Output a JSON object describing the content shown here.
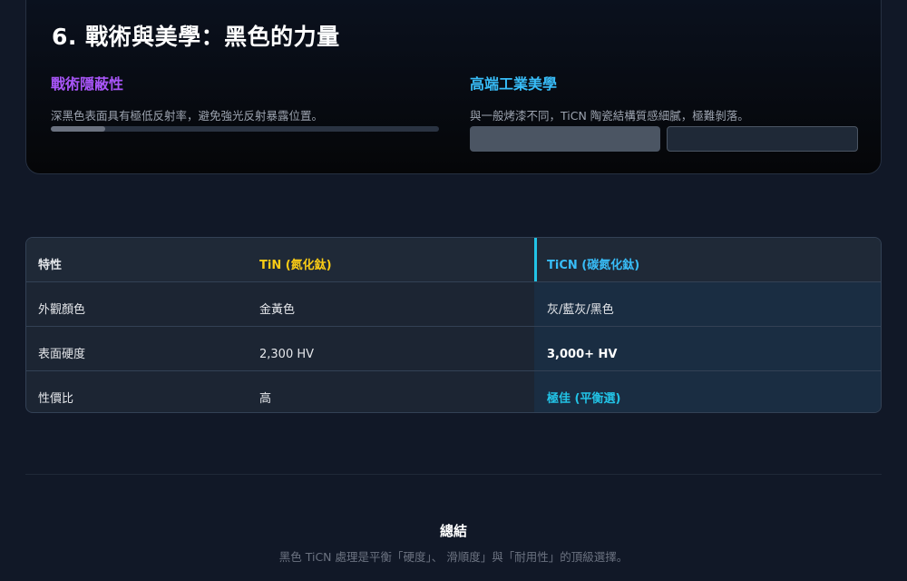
{
  "section": {
    "title": "6. 戰術與美學：黑色的力量",
    "left": {
      "title": "戰術隱蔽性",
      "description": "深黑色表面具有極低反射率，避免強光反射暴露位置。",
      "reflectivity_fraction": 0.14
    },
    "right": {
      "title": "高端工業美學",
      "description": "與一般烤漆不同，TiCN 陶瓷結構質感細膩，極難剝落。"
    },
    "colors": {
      "left_accent": "#a855f7",
      "right_accent": "#38bdf8",
      "swatch_a": "#4b5563",
      "swatch_b": "#1f2937"
    }
  },
  "table": {
    "headers": [
      "特性",
      "TiN (氮化鈦)",
      "TiCN (碳氮化鈦)"
    ],
    "rows": [
      [
        "外觀顏色",
        "金黃色",
        "灰/藍灰/黑色"
      ],
      [
        "表面硬度",
        "2,300 HV",
        "3,000+ HV"
      ],
      [
        "性價比",
        "高",
        "極佳 (平衡選)"
      ]
    ],
    "colors": {
      "tin": "#facc15",
      "ticn": "#38bdf8",
      "highlight": "#22c3e6"
    }
  },
  "summary": {
    "title": "總結",
    "text": "黑色 TiCN 處理是平衡「硬度」、 滑順度」與「耐用性」的頂級選擇。"
  }
}
